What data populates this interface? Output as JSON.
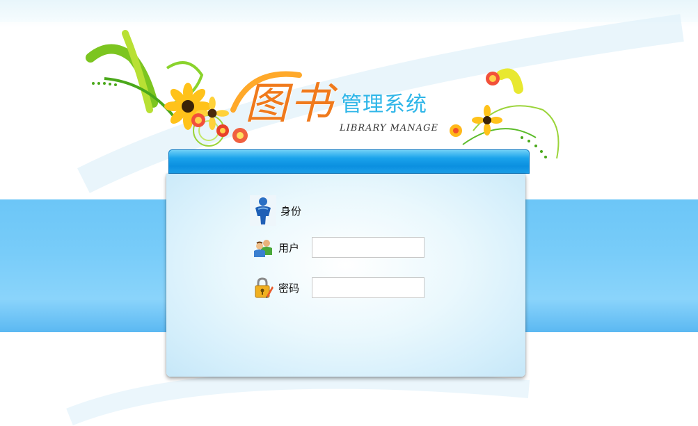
{
  "header": {
    "title_main": "图书",
    "title_sub": "管理系统",
    "title_en": "LIBRARY MANAGE"
  },
  "form": {
    "identity_label": "身份",
    "user_label": "用户",
    "user_value": "",
    "password_label": "密码",
    "password_value": ""
  },
  "icons": {
    "identity": "person-figure-icon",
    "user": "users-icon",
    "password": "padlock-pencil-icon"
  },
  "colors": {
    "title_main": "#f07a1c",
    "title_sub": "#2fb6e8",
    "header_bar": "#0b8fe0",
    "sky_band": "#78ccf9"
  }
}
